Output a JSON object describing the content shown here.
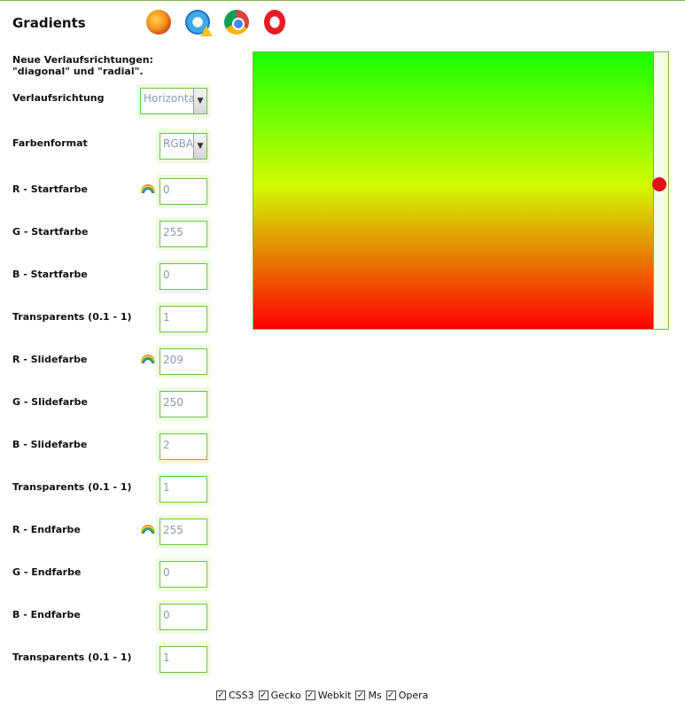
{
  "title": "Gradients",
  "icons": [
    "firefox-icon",
    "internet-explorer-icon",
    "chrome-icon",
    "opera-icon",
    "rainbow-icon"
  ],
  "intro": {
    "line1": "Neue Verlaufsrichtungen:",
    "line2": "\"diagonal\" und \"radial\"."
  },
  "direction": {
    "label": "Verlaufsrichtung",
    "value": "Horizontal"
  },
  "format": {
    "label": "Farbenformat",
    "value": "RGBA"
  },
  "fields": [
    {
      "label": "R - Startfarbe",
      "value": "0",
      "rainbow": true
    },
    {
      "label": "G - Startfarbe",
      "value": "255"
    },
    {
      "label": "B - Startfarbe",
      "value": "0"
    },
    {
      "label": "Transparents (0.1 - 1)",
      "value": "1"
    },
    {
      "label": "R - Slidefarbe",
      "value": "209",
      "rainbow": true
    },
    {
      "label": "G - Slidefarbe",
      "value": "250"
    },
    {
      "label": "B - Slidefarbe",
      "value": "2"
    },
    {
      "label": "Transparents (0.1 - 1)",
      "value": "1"
    },
    {
      "label": "R - Endfarbe",
      "value": "255",
      "rainbow": true
    },
    {
      "label": "G - Endfarbe",
      "value": "0"
    },
    {
      "label": "B - Endfarbe",
      "value": "0"
    },
    {
      "label": "Transparents (0.1 - 1)",
      "value": "1"
    }
  ],
  "preview": {
    "start_color": "#18ff00",
    "slide_color": "#d1fa02",
    "end_color": "#ff0000",
    "slider_position_fraction": 0.48,
    "knob_color": "#e0121c"
  },
  "checkboxes": [
    {
      "label": "CSS3",
      "checked": true
    },
    {
      "label": "Gecko",
      "checked": true
    },
    {
      "label": "Webkit",
      "checked": true
    },
    {
      "label": "Ms",
      "checked": true
    },
    {
      "label": "Opera",
      "checked": true
    }
  ]
}
